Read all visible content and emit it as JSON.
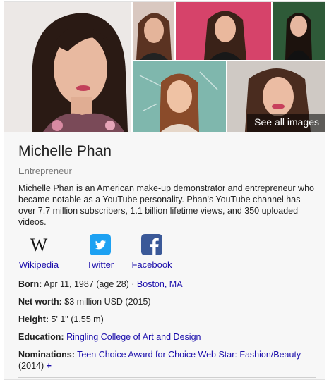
{
  "images": {
    "see_all_label": "See all images"
  },
  "entity": {
    "name": "Michelle Phan",
    "subtitle": "Entrepreneur",
    "description": "Michelle Phan is an American make-up demonstrator and entrepreneur who became notable as a YouTube personality. Phan's YouTube channel has over 7.7 million subscribers, 1.1 billion lifetime views, and 350 uploaded videos."
  },
  "profiles": [
    {
      "label": "Wikipedia",
      "icon": "wikipedia-icon"
    },
    {
      "label": "Twitter",
      "icon": "twitter-icon",
      "color": "#1da1f2"
    },
    {
      "label": "Facebook",
      "icon": "facebook-icon",
      "color": "#3b5998"
    }
  ],
  "facts": {
    "born": {
      "label": "Born:",
      "value": "Apr 11, 1987 (age 28)",
      "sep": " · ",
      "place": "Boston, MA"
    },
    "net_worth": {
      "label": "Net worth:",
      "value": "$3 million USD (2015)"
    },
    "height": {
      "label": "Height:",
      "value": "5' 1\" (1.55 m)"
    },
    "education": {
      "label": "Education:",
      "value": "Ringling College of Art and Design"
    },
    "nominations": {
      "label": "Nominations:",
      "link": "Teen Choice Award for Choice Web Star: Fashion/Beauty",
      "year": " (2014)",
      "more": "+"
    }
  },
  "colors": {
    "link": "#1a0dab",
    "panel_bg": "#f7f7f7"
  }
}
